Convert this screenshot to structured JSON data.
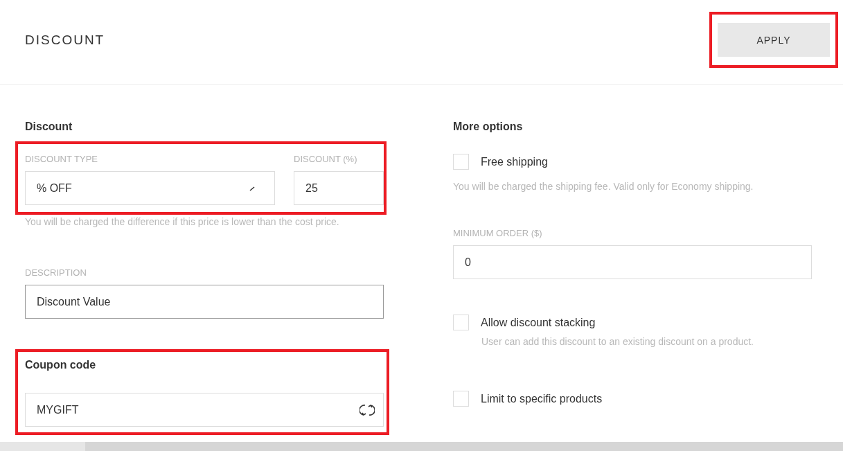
{
  "header": {
    "title": "DISCOUNT",
    "apply_button": {
      "label": "APPLY",
      "highlighted": true
    }
  },
  "discount": {
    "heading": "Discount",
    "highlighted": true,
    "type_field": {
      "label": "DISCOUNT TYPE",
      "value": "% OFF"
    },
    "amount_field": {
      "label": "DISCOUNT (%)",
      "value": "25"
    },
    "hint": "You will be charged the difference if this price is lower than the cost price.",
    "description": {
      "label": "DESCRIPTION",
      "value": "Discount Value"
    }
  },
  "coupon": {
    "heading": "Coupon code",
    "value": "MYGIFT",
    "highlighted": true
  },
  "more_options": {
    "heading": "More options",
    "items": [
      {
        "kind": "checkbox",
        "label": "Free shipping",
        "checked": false
      },
      {
        "kind": "note",
        "text": "You will be charged the shipping fee. Valid only for Economy shipping."
      },
      {
        "kind": "field",
        "label": "MINIMUM ORDER ($)",
        "value": "0"
      },
      {
        "kind": "checkbox",
        "label": "Allow discount stacking",
        "checked": false,
        "hint": "User can add this discount to an existing discount on a product."
      },
      {
        "kind": "checkbox",
        "label": "Limit to specific products",
        "checked": false
      }
    ]
  }
}
